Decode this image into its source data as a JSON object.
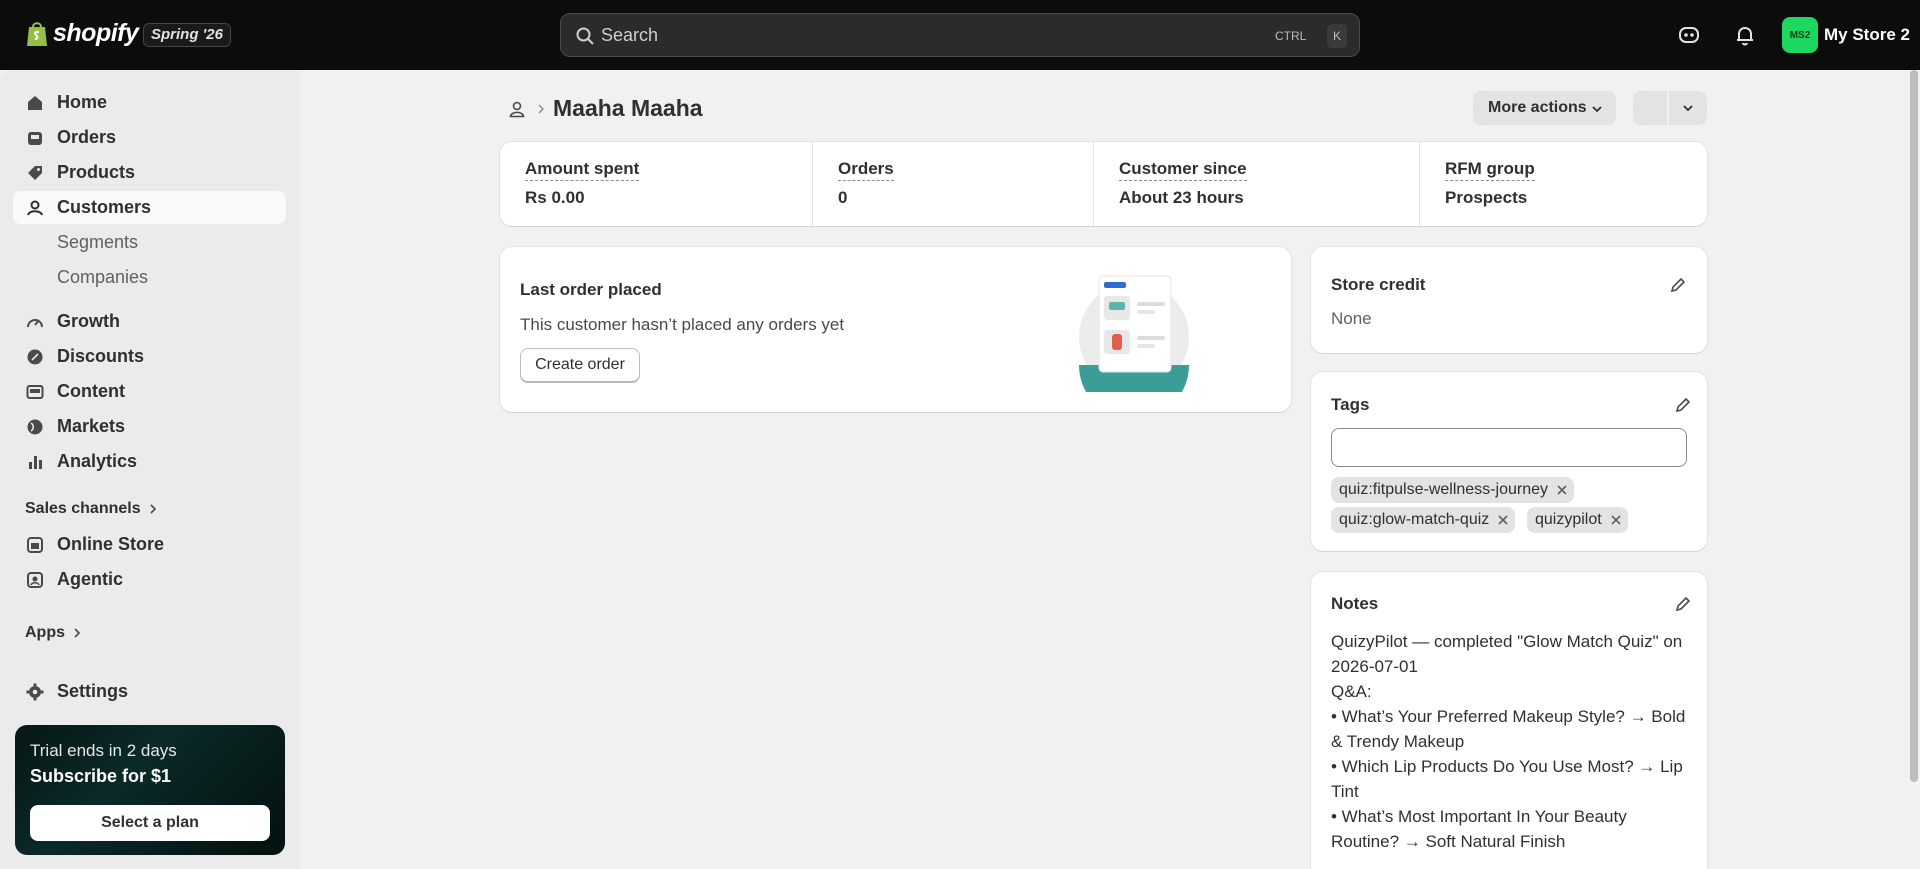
{
  "brand": {
    "name": "shopify",
    "badge": "Spring '26"
  },
  "search": {
    "placeholder": "Search",
    "shortcut_1": "CTRL",
    "shortcut_2": "K"
  },
  "store": {
    "initials": "MS2",
    "name": "My Store 2",
    "avatar_color": "#1ed760"
  },
  "sidebar": {
    "items": [
      {
        "label": "Home",
        "icon": "home-icon"
      },
      {
        "label": "Orders",
        "icon": "inbox-icon"
      },
      {
        "label": "Products",
        "icon": "tag-icon"
      },
      {
        "label": "Customers",
        "icon": "person-icon"
      },
      {
        "label": "Segments"
      },
      {
        "label": "Companies"
      },
      {
        "label": "Growth",
        "icon": "gauge-icon"
      },
      {
        "label": "Discounts",
        "icon": "discount-icon"
      },
      {
        "label": "Content",
        "icon": "image-icon"
      },
      {
        "label": "Markets",
        "icon": "globe-icon"
      },
      {
        "label": "Analytics",
        "icon": "bar-chart-icon"
      }
    ],
    "sales_channels_label": "Sales channels",
    "channels": [
      {
        "label": "Online Store",
        "icon": "store-icon"
      },
      {
        "label": "Agentic",
        "icon": "agent-icon"
      }
    ],
    "apps_label": "Apps",
    "settings_label": "Settings",
    "trial": {
      "line1": "Trial ends in 2 days",
      "line2": "Subscribe for $1",
      "button": "Select a plan"
    }
  },
  "page": {
    "title": "Maaha Maaha",
    "more_actions": "More actions"
  },
  "stats": [
    {
      "label": "Amount spent",
      "value": "Rs 0.00"
    },
    {
      "label": "Orders",
      "value": "0"
    },
    {
      "label": "Customer since",
      "value": "About 23 hours"
    },
    {
      "label": "RFM group",
      "value": "Prospects"
    }
  ],
  "last_order": {
    "title": "Last order placed",
    "message": "This customer hasn’t placed any orders yet",
    "button": "Create order"
  },
  "store_credit": {
    "title": "Store credit",
    "value": "None"
  },
  "tags": {
    "title": "Tags",
    "input_value": "",
    "items": [
      "quiz:fitpulse-wellness-journey",
      "quiz:glow-match-quiz",
      "quizypilot"
    ]
  },
  "notes": {
    "title": "Notes",
    "text": "QuizyPilot — completed \"Glow Match Quiz\" on 2026-07-01\nQ&A:\n• What’s Your Preferred Makeup Style? → Bold & Trendy Makeup\n• Which Lip Products Do You Use Most? → Lip Tint\n• What’s Most Important In Your Beauty Routine? → Soft Natural Finish\n..."
  }
}
